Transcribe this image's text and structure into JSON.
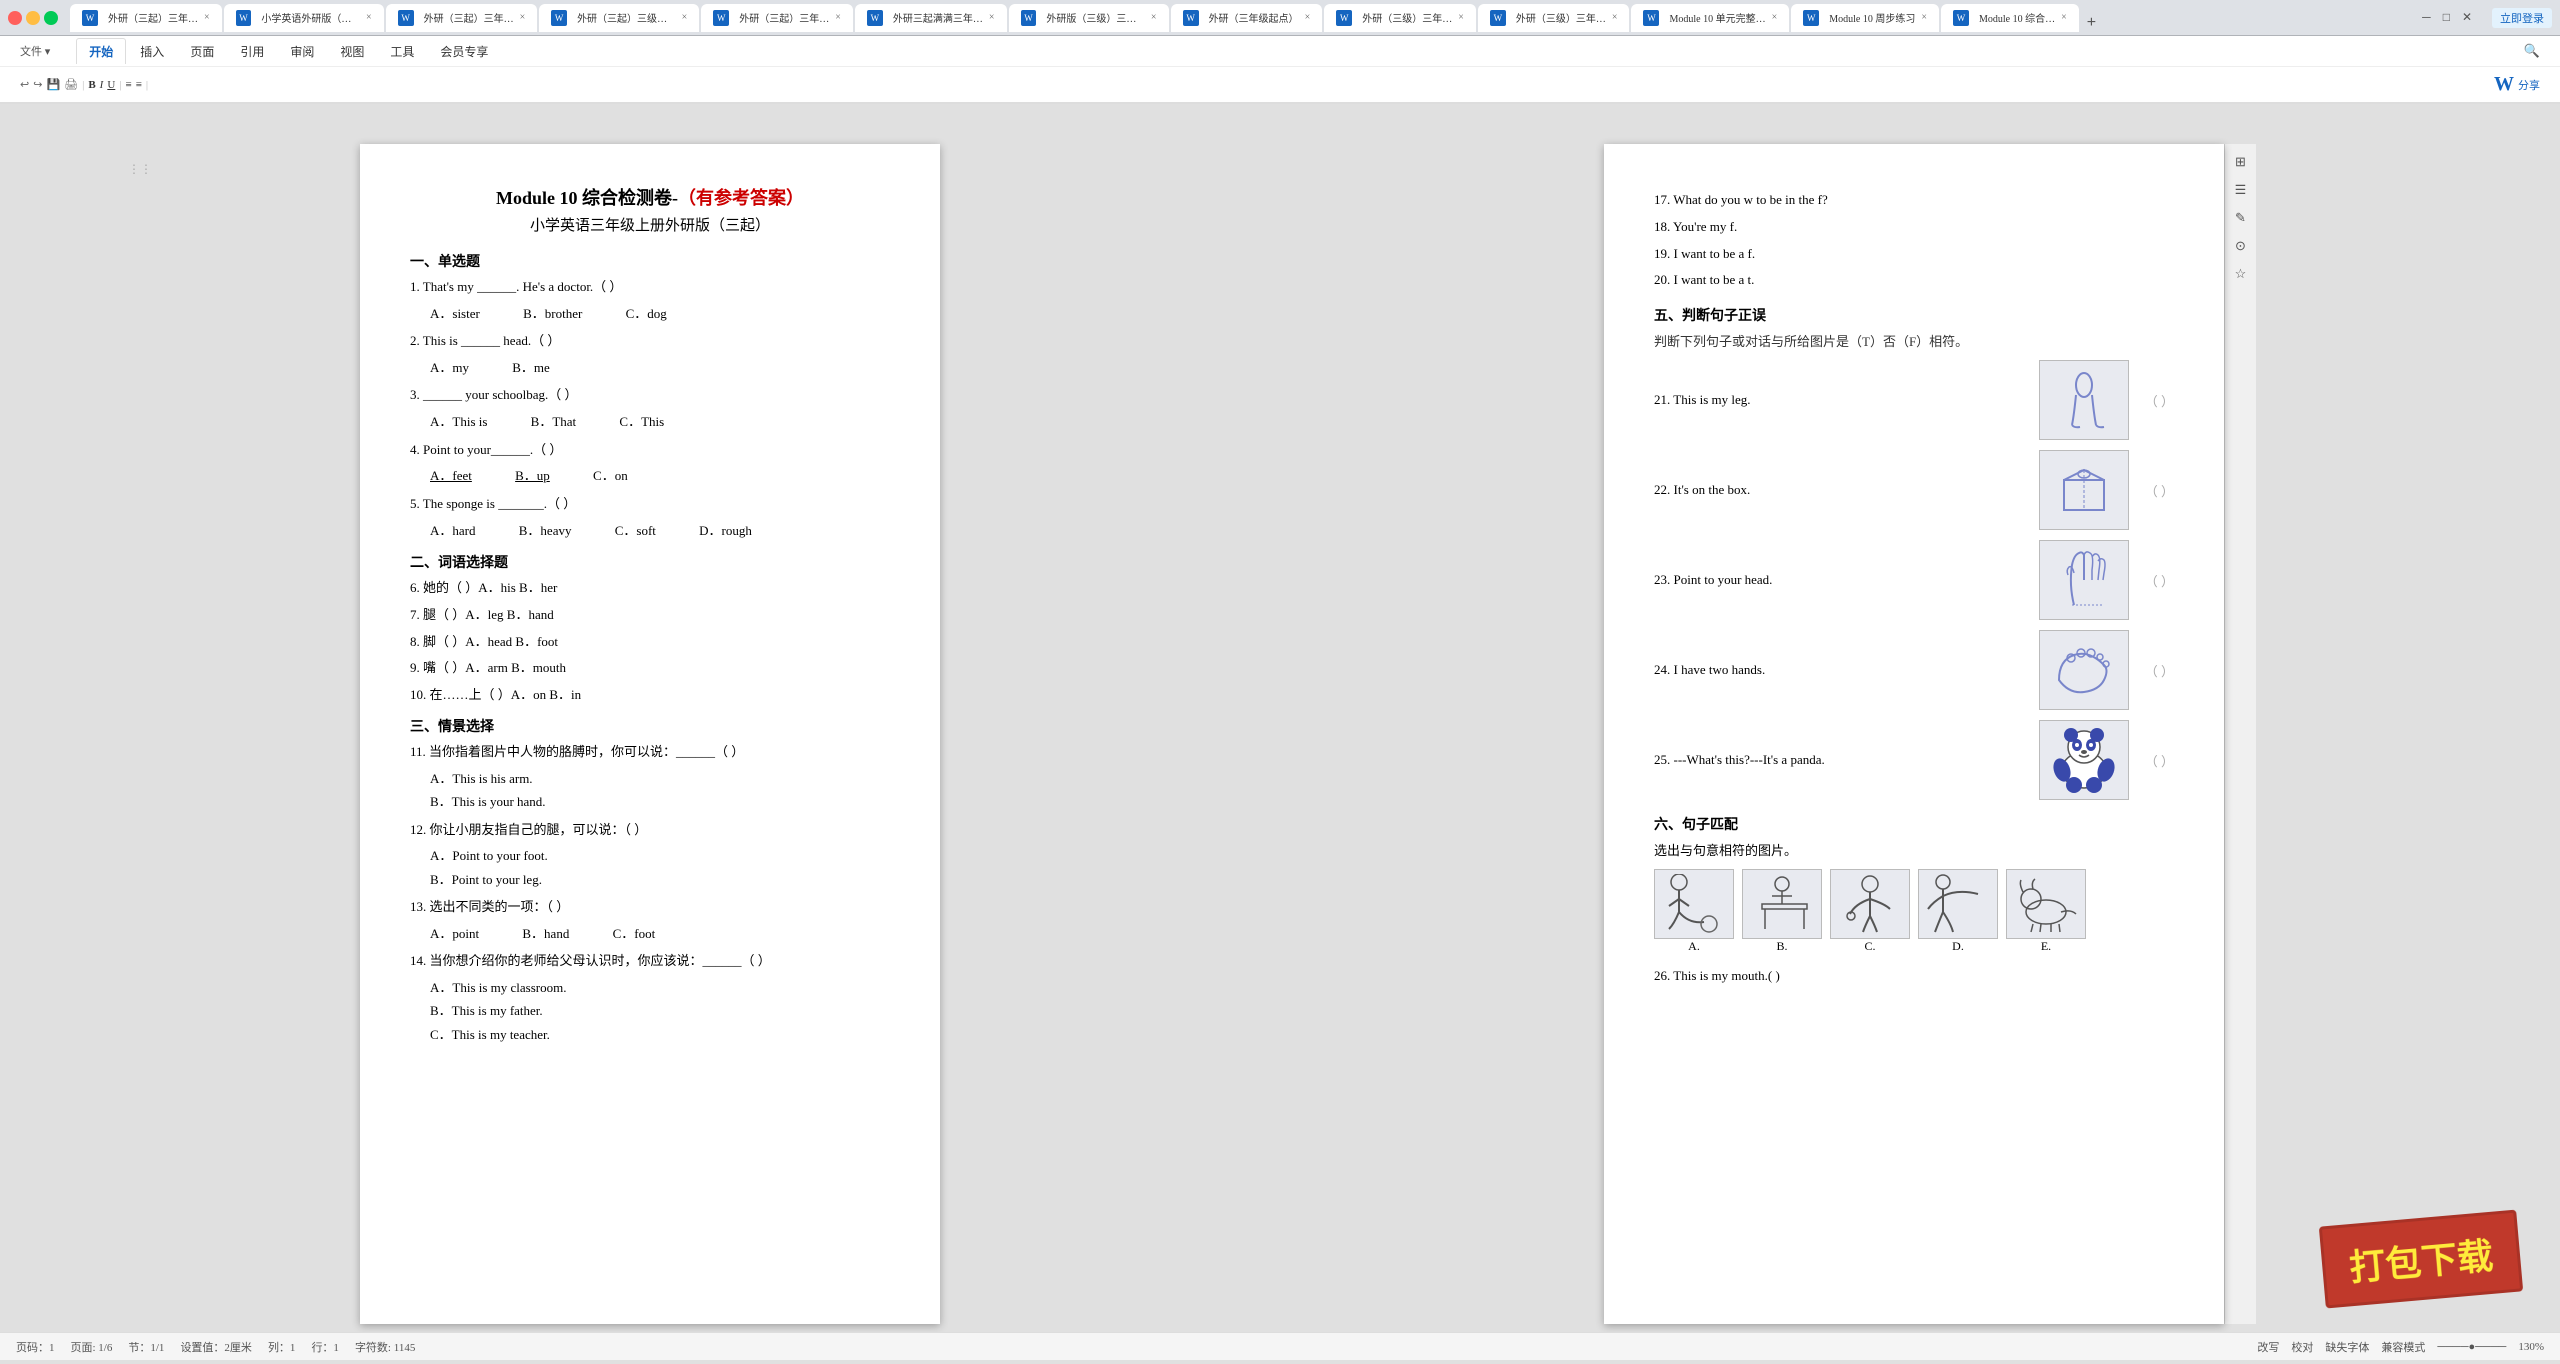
{
  "browser": {
    "tabs": [
      {
        "label": "外研（三起）三年…",
        "active": false
      },
      {
        "label": "小学英语外研版（三…",
        "active": false
      },
      {
        "label": "外研（三起）三年…",
        "active": false
      },
      {
        "label": "外研（三起）三级必…",
        "active": false
      },
      {
        "label": "外研（三起）三年…",
        "active": false
      },
      {
        "label": "外研三起满满三年…",
        "active": false
      },
      {
        "label": "外研版（三级）三年…",
        "active": false
      },
      {
        "label": "外研（三年级起点）",
        "active": false
      },
      {
        "label": "外研（三级）三年…",
        "active": false
      },
      {
        "label": "外研（三级）三年…",
        "active": false
      },
      {
        "label": "Module 10 单元完整…",
        "active": false
      },
      {
        "label": "Module 10 周步练习",
        "active": false
      },
      {
        "label": "Module 10 综合…",
        "active": true
      }
    ],
    "new_tab_label": "+"
  },
  "toolbar": {
    "tabs": [
      "开始",
      "插入",
      "页面",
      "引用",
      "审阅",
      "视图",
      "工具",
      "会员专享"
    ],
    "active_tab": "开始"
  },
  "left_doc": {
    "title_black": "Module 10 综合检测卷-",
    "title_red": "（有参考答案）",
    "subtitle": "小学英语三年级上册外研版（三起）",
    "section1": "一、单选题",
    "q1": "1.  That's my ______. He's a doctor.（  ）",
    "q1_a": "A．sister",
    "q1_b": "B．brother",
    "q1_c": "C．dog",
    "q2": "2.  This is ______ head.（  ）",
    "q2_a": "A．my",
    "q2_b": "B．me",
    "q3": "3.  ______ your schoolbag.（  ）",
    "q3_a": "A．This is",
    "q3_b": "B．That",
    "q3_c": "C．This",
    "q4": "4.  Point to your______.（  ）",
    "q4_a": "A．feet",
    "q4_b": "B．up",
    "q4_c": "C．on",
    "q5": "5.  The sponge is _______.（  ）",
    "q5_a": "A．hard",
    "q5_b": "B．heavy",
    "q5_c": "C．soft",
    "q5_d": "D．rough",
    "section2": "二、词语选择题",
    "q6": "6.  她的（  ）A．his    B．her",
    "q7": "7.  腿（  ）A．leg   B．hand",
    "q8": "8.  脚（  ）A．head   B．foot",
    "q9": "9.  嘴（  ）A．arm   B．mouth",
    "q10": "10.  在……上（  ）A．on    B．in",
    "section3": "三、情景选择",
    "q11": "11.  当你指着图片中人物的胳膊时，你可以说：______（  ）",
    "q11_a": "A．This is his arm.",
    "q11_b": "B．This is your hand.",
    "q12": "12.  你让小朋友指自己的腿，可以说：（  ）",
    "q12_a": "A．Point to your foot.",
    "q12_b": "B．Point to your leg.",
    "q13": "13.  选出不同类的一项：（  ）",
    "q13_a": "A．point",
    "q13_b": "B．hand",
    "q13_c": "C．foot",
    "q14": "14.  当你想介绍你的老师给父母认识时，你应该说：______（  ）",
    "q14_a": "A．This is my classroom.",
    "q14_b": "B．This is my father.",
    "q14_c": "C．This is my teacher."
  },
  "right_doc": {
    "q17": "17.  What do you w to be in the f?",
    "q18": "18.  You're my f.",
    "q19": "19.  I want to be a f.",
    "q20": "20.  I want to be a t.",
    "section5": "五、判断句子正误",
    "section5_desc": "判断下列句子或对话与所给图片是（T）否（F）相符。",
    "q21": "21.  This is my leg.",
    "q22": "22.  It's on the box.",
    "q23": "23.  Point to your head.",
    "q24": "24.  I have two hands.",
    "q25": "25.  ---What's this?---It's a panda.",
    "section6": "六、句子匹配",
    "section6_desc": "选出与句意相符的图片。",
    "match_labels": [
      "A.",
      "B.",
      "C.",
      "D.",
      "E."
    ],
    "q26": "26.  This is my mouth.(    )"
  },
  "status": {
    "page": "页码：1",
    "pages": "页面: 1/6",
    "section_info": "节：1/1",
    "position": "设置值：2厘米",
    "col_info": "列：1",
    "row_info": "行：1",
    "char_info": "字符数: 1145",
    "mode1": "改写",
    "mode2": "校对",
    "mode3": "缺失字体",
    "mode4": "兼容模式",
    "zoom": "130%"
  },
  "download_stamp": "打包下载",
  "icons": {
    "leg": "🦵",
    "box": "📦",
    "hand": "✋",
    "foot": "🦶",
    "panda": "🐼"
  }
}
